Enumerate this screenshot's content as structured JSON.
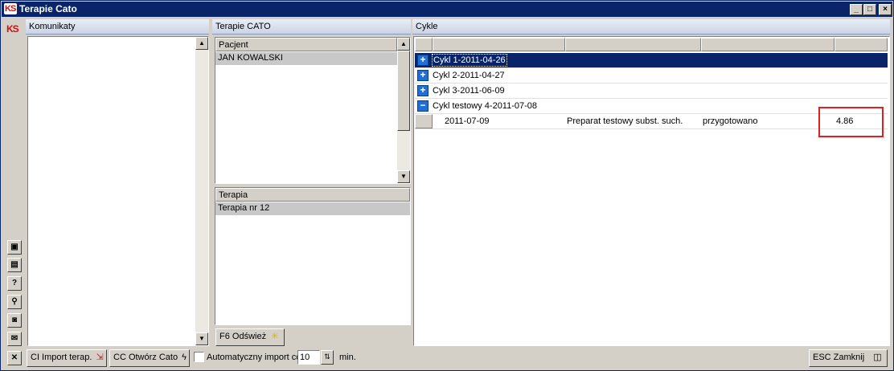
{
  "window": {
    "title": "Terapie Cato",
    "app_icon": "KS",
    "controls": {
      "minimize": "_",
      "maximize": "□",
      "close": "×"
    }
  },
  "left_toolbar": {
    "logo": "KS",
    "buttons": [
      {
        "icon": "monitor-icon",
        "glyph": "▣"
      },
      {
        "icon": "calculator-icon",
        "glyph": "▤"
      },
      {
        "icon": "help-icon",
        "glyph": "?"
      },
      {
        "icon": "search-icon",
        "glyph": "⚲"
      },
      {
        "icon": "camera-icon",
        "glyph": "◙"
      },
      {
        "icon": "mail-icon",
        "glyph": "✉"
      },
      {
        "icon": "close-icon",
        "glyph": "✕"
      }
    ]
  },
  "messages_panel": {
    "title": "Komunikaty"
  },
  "cato_panel": {
    "title": "Terapie CATO",
    "patients": {
      "column": "Pacjent",
      "rows": [
        "JAN KOWALSKI"
      ]
    },
    "therapies": {
      "column": "Terapia",
      "rows": [
        "Terapia nr 12"
      ]
    },
    "refresh_button": "F6 Odśwież"
  },
  "cycles_panel": {
    "title": "Cykle",
    "rows": [
      {
        "expander": "+",
        "label": "Cykl 1-2011-04-26",
        "selected": true
      },
      {
        "expander": "+",
        "label": "Cykl 2-2011-04-27",
        "selected": false
      },
      {
        "expander": "+",
        "label": "Cykl 3-2011-06-09",
        "selected": false
      },
      {
        "expander": "−",
        "label": "Cykl testowy 4-2011-07-08",
        "selected": false
      }
    ],
    "detail": {
      "date": "2011-07-09",
      "product": "Preparat testowy subst. such.",
      "status": "przygotowano",
      "value": "4.86"
    }
  },
  "bottom_bar": {
    "import_button": "CI Import terap.",
    "open_button": "CC Otwórz Cato",
    "auto_import_label": "Automatyczny import co",
    "auto_import_value": "10",
    "auto_import_unit": "min.",
    "close_button": "ESC Zamknij"
  },
  "colors": {
    "titlebar": "#0a246a",
    "selection": "#0a246a",
    "expander": "#1f6fd6",
    "highlight_box": "#e02020",
    "panel_header": "#c9d4e6"
  }
}
